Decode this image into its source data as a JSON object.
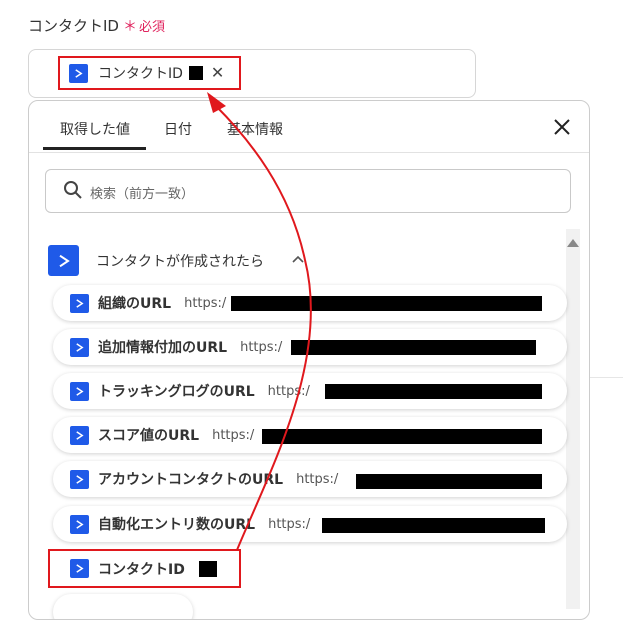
{
  "field": {
    "label": "コンタクトID",
    "required_mark": "＊",
    "required_text": "必須",
    "selected_chip": "コンタクトID"
  },
  "tabs": [
    {
      "label": "取得した値",
      "active": true
    },
    {
      "label": "日付",
      "active": false
    },
    {
      "label": "基本情報",
      "active": false
    }
  ],
  "search": {
    "placeholder": "検索（前方一致）"
  },
  "group": {
    "title": "コンタクトが作成されたら"
  },
  "items": [
    {
      "label": "組織のURL",
      "url_prefix": "https:/"
    },
    {
      "label": "追加情報付加のURL",
      "url_prefix": "https:/"
    },
    {
      "label": "トラッキングログのURL",
      "url_prefix": "https:/"
    },
    {
      "label": "スコア値のURL",
      "url_prefix": "https:/"
    },
    {
      "label": "アカウントコンタクトのURL",
      "url_prefix": "https:/"
    },
    {
      "label": "自動化エントリ数のURL",
      "url_prefix": "https:/"
    },
    {
      "label": "コンタクトID",
      "url_prefix": ""
    }
  ],
  "colors": {
    "accent": "#1f5ae8",
    "highlight": "#e0181d",
    "required": "#e0245e"
  }
}
